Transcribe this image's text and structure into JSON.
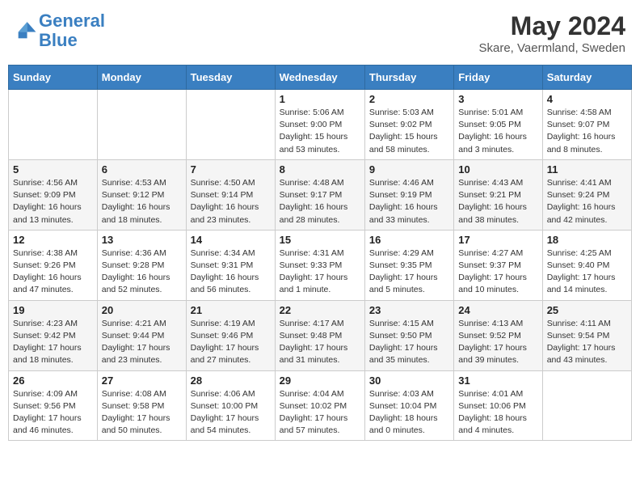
{
  "header": {
    "logo_line1": "General",
    "logo_line2": "Blue",
    "month": "May 2024",
    "location": "Skare, Vaermland, Sweden"
  },
  "days_of_week": [
    "Sunday",
    "Monday",
    "Tuesday",
    "Wednesday",
    "Thursday",
    "Friday",
    "Saturday"
  ],
  "weeks": [
    [
      {
        "day": "",
        "info": ""
      },
      {
        "day": "",
        "info": ""
      },
      {
        "day": "",
        "info": ""
      },
      {
        "day": "1",
        "info": "Sunrise: 5:06 AM\nSunset: 9:00 PM\nDaylight: 15 hours\nand 53 minutes."
      },
      {
        "day": "2",
        "info": "Sunrise: 5:03 AM\nSunset: 9:02 PM\nDaylight: 15 hours\nand 58 minutes."
      },
      {
        "day": "3",
        "info": "Sunrise: 5:01 AM\nSunset: 9:05 PM\nDaylight: 16 hours\nand 3 minutes."
      },
      {
        "day": "4",
        "info": "Sunrise: 4:58 AM\nSunset: 9:07 PM\nDaylight: 16 hours\nand 8 minutes."
      }
    ],
    [
      {
        "day": "5",
        "info": "Sunrise: 4:56 AM\nSunset: 9:09 PM\nDaylight: 16 hours\nand 13 minutes."
      },
      {
        "day": "6",
        "info": "Sunrise: 4:53 AM\nSunset: 9:12 PM\nDaylight: 16 hours\nand 18 minutes."
      },
      {
        "day": "7",
        "info": "Sunrise: 4:50 AM\nSunset: 9:14 PM\nDaylight: 16 hours\nand 23 minutes."
      },
      {
        "day": "8",
        "info": "Sunrise: 4:48 AM\nSunset: 9:17 PM\nDaylight: 16 hours\nand 28 minutes."
      },
      {
        "day": "9",
        "info": "Sunrise: 4:46 AM\nSunset: 9:19 PM\nDaylight: 16 hours\nand 33 minutes."
      },
      {
        "day": "10",
        "info": "Sunrise: 4:43 AM\nSunset: 9:21 PM\nDaylight: 16 hours\nand 38 minutes."
      },
      {
        "day": "11",
        "info": "Sunrise: 4:41 AM\nSunset: 9:24 PM\nDaylight: 16 hours\nand 42 minutes."
      }
    ],
    [
      {
        "day": "12",
        "info": "Sunrise: 4:38 AM\nSunset: 9:26 PM\nDaylight: 16 hours\nand 47 minutes."
      },
      {
        "day": "13",
        "info": "Sunrise: 4:36 AM\nSunset: 9:28 PM\nDaylight: 16 hours\nand 52 minutes."
      },
      {
        "day": "14",
        "info": "Sunrise: 4:34 AM\nSunset: 9:31 PM\nDaylight: 16 hours\nand 56 minutes."
      },
      {
        "day": "15",
        "info": "Sunrise: 4:31 AM\nSunset: 9:33 PM\nDaylight: 17 hours\nand 1 minute."
      },
      {
        "day": "16",
        "info": "Sunrise: 4:29 AM\nSunset: 9:35 PM\nDaylight: 17 hours\nand 5 minutes."
      },
      {
        "day": "17",
        "info": "Sunrise: 4:27 AM\nSunset: 9:37 PM\nDaylight: 17 hours\nand 10 minutes."
      },
      {
        "day": "18",
        "info": "Sunrise: 4:25 AM\nSunset: 9:40 PM\nDaylight: 17 hours\nand 14 minutes."
      }
    ],
    [
      {
        "day": "19",
        "info": "Sunrise: 4:23 AM\nSunset: 9:42 PM\nDaylight: 17 hours\nand 18 minutes."
      },
      {
        "day": "20",
        "info": "Sunrise: 4:21 AM\nSunset: 9:44 PM\nDaylight: 17 hours\nand 23 minutes."
      },
      {
        "day": "21",
        "info": "Sunrise: 4:19 AM\nSunset: 9:46 PM\nDaylight: 17 hours\nand 27 minutes."
      },
      {
        "day": "22",
        "info": "Sunrise: 4:17 AM\nSunset: 9:48 PM\nDaylight: 17 hours\nand 31 minutes."
      },
      {
        "day": "23",
        "info": "Sunrise: 4:15 AM\nSunset: 9:50 PM\nDaylight: 17 hours\nand 35 minutes."
      },
      {
        "day": "24",
        "info": "Sunrise: 4:13 AM\nSunset: 9:52 PM\nDaylight: 17 hours\nand 39 minutes."
      },
      {
        "day": "25",
        "info": "Sunrise: 4:11 AM\nSunset: 9:54 PM\nDaylight: 17 hours\nand 43 minutes."
      }
    ],
    [
      {
        "day": "26",
        "info": "Sunrise: 4:09 AM\nSunset: 9:56 PM\nDaylight: 17 hours\nand 46 minutes."
      },
      {
        "day": "27",
        "info": "Sunrise: 4:08 AM\nSunset: 9:58 PM\nDaylight: 17 hours\nand 50 minutes."
      },
      {
        "day": "28",
        "info": "Sunrise: 4:06 AM\nSunset: 10:00 PM\nDaylight: 17 hours\nand 54 minutes."
      },
      {
        "day": "29",
        "info": "Sunrise: 4:04 AM\nSunset: 10:02 PM\nDaylight: 17 hours\nand 57 minutes."
      },
      {
        "day": "30",
        "info": "Sunrise: 4:03 AM\nSunset: 10:04 PM\nDaylight: 18 hours\nand 0 minutes."
      },
      {
        "day": "31",
        "info": "Sunrise: 4:01 AM\nSunset: 10:06 PM\nDaylight: 18 hours\nand 4 minutes."
      },
      {
        "day": "",
        "info": ""
      }
    ]
  ]
}
